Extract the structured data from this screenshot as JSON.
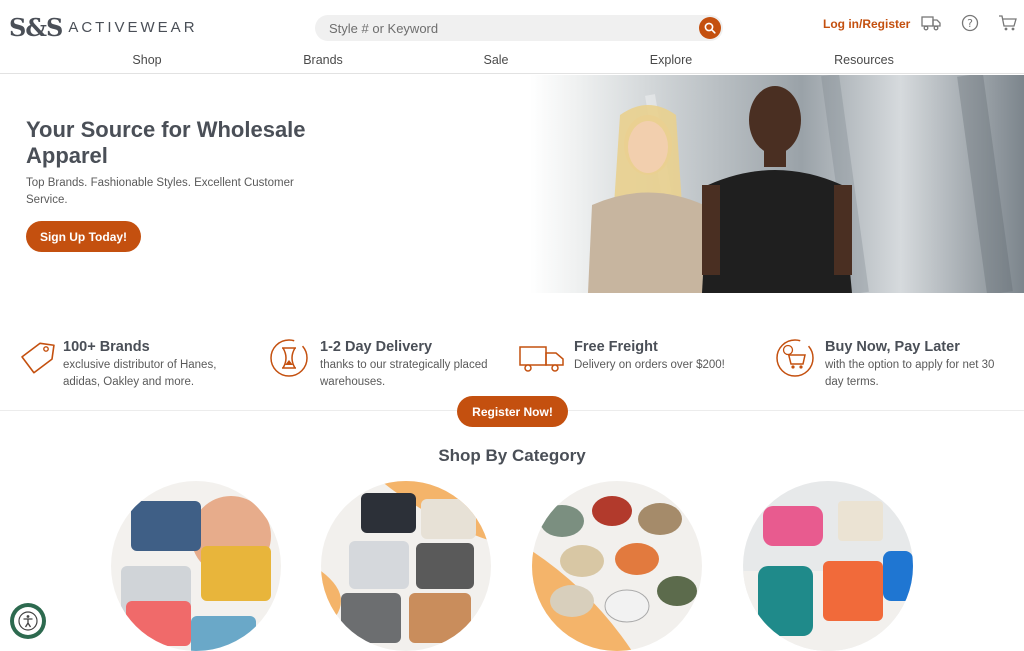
{
  "header": {
    "logo_mark": "S&S",
    "logo_text": "ACTIVEWEAR",
    "search_placeholder": "Style # or Keyword",
    "login_label": "Log in/Register",
    "icons": [
      "truck-icon",
      "help-icon",
      "cart-icon",
      "search-icon"
    ]
  },
  "nav": {
    "items": [
      "Shop",
      "Brands",
      "Sale",
      "Explore",
      "Resources"
    ]
  },
  "hero": {
    "title": "Your Source for Wholesale Apparel",
    "subtitle": "Top Brands. Fashionable Styles. Excellent Customer Service.",
    "cta": "Sign Up Today!"
  },
  "features": [
    {
      "title": "100+ Brands",
      "desc": "exclusive distributor of Hanes, adidas, Oakley and more.",
      "icon": "tag-icon"
    },
    {
      "title": "1-2 Day Delivery",
      "desc": "thanks to our strategically placed warehouses.",
      "icon": "hourglass-icon"
    },
    {
      "title": "Free Freight",
      "desc": "Delivery on orders over $200!",
      "icon": "truck-icon"
    },
    {
      "title": "Buy Now, Pay Later",
      "desc": "with the option to apply for net 30 day terms.",
      "icon": "cart-clock-icon"
    }
  ],
  "register_cta": "Register Now!",
  "categories": {
    "title": "Shop By Category"
  },
  "colors": {
    "accent": "#c4500f",
    "text_dark": "#4a4f57",
    "search_bg": "#f0f0f0",
    "category_orange": "#f4a460"
  }
}
